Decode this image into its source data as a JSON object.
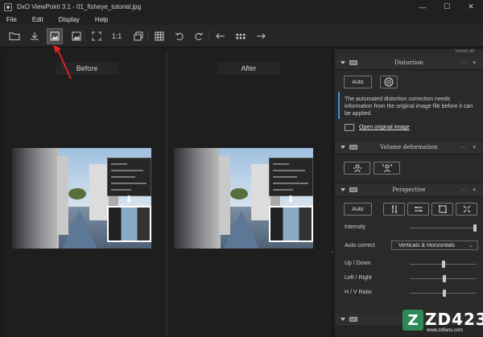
{
  "window": {
    "title": "DxO ViewPoint 3.1 - 01_fisheye_tutorial.jpg",
    "minimize": "—",
    "maximize": "☐",
    "close": "✕"
  },
  "menu": [
    "File",
    "Edit",
    "Display",
    "Help"
  ],
  "toolbar": {
    "zoom_fit": "1:1"
  },
  "viewer": {
    "before_label": "Before",
    "after_label": "After"
  },
  "panel": {
    "reset_all": "Reset all",
    "distortion": {
      "title": "Distortion",
      "auto_label": "Auto",
      "info_text": "The automated distortion correction needs information from the original image file before it can be applied.",
      "open_link": "Open original image"
    },
    "volume": {
      "title": "Volume deformation"
    },
    "perspective": {
      "title": "Perspective",
      "auto_label": "Auto",
      "intensity_label": "Intensity",
      "intensity_value": 1.0,
      "auto_correct_label": "Auto correct",
      "auto_correct_value": "Verticals & Horizontals",
      "up_down_label": "Up / Down",
      "up_down_value": 0.5,
      "left_right_label": "Left / Right",
      "left_right_value": 0.52,
      "hv_ratio_label": "H / V Ratio",
      "hv_ratio_value": 0.52
    }
  },
  "watermark": {
    "logo_letter": "Z",
    "brand": "ZD423",
    "url": "www.zdfans.com"
  }
}
